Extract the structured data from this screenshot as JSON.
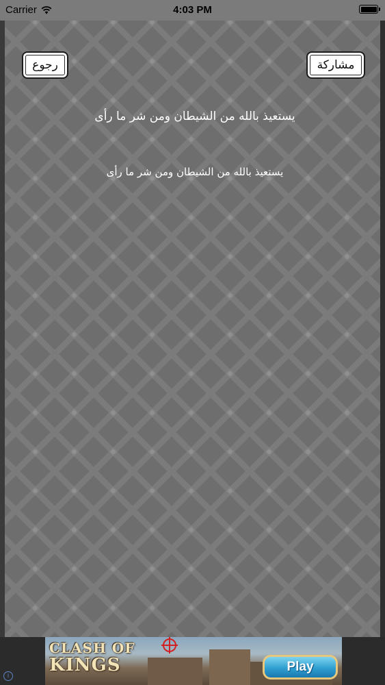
{
  "status_bar": {
    "carrier": "Carrier",
    "time": "4:03 PM",
    "wifi_icon": "wifi-icon",
    "battery_icon": "battery-icon",
    "battery_level": 1.0
  },
  "toolbar": {
    "back_label": "رجوع",
    "share_label": "مشاركة"
  },
  "content": {
    "zikr_lines": [
      "يستعيذ بالله من الشيطان ومن شر ما رأى",
      "يستعيذ بالله من الشيطان ومن شر ما رأى"
    ]
  },
  "ad": {
    "info_icon": "info-icon",
    "logo_line1": "CLASH OF",
    "logo_line2": "KINGS",
    "play_label": "Play",
    "colors": {
      "play_button": "#2f9fd0",
      "play_border": "#e7c77c"
    }
  },
  "colors": {
    "background_pattern": "#6e6e6e",
    "text": "#ffffff",
    "button_bg": "#ffffff"
  }
}
